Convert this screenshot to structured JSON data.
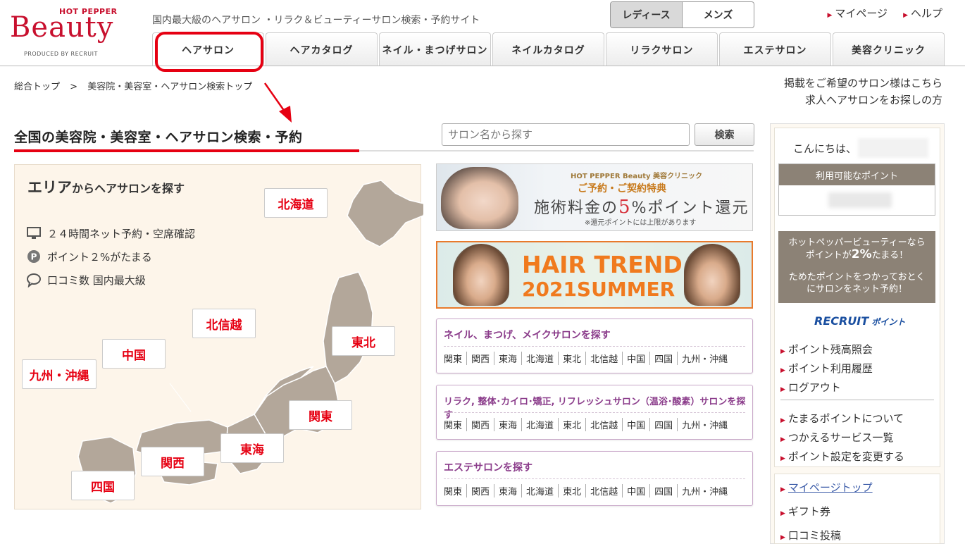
{
  "header": {
    "logo_top": "HOT PEPPER",
    "logo_main": "Beauty",
    "logo_sub": "PRODUCED BY RECRUIT",
    "tagline": "国内最大級のヘアサロン ・リラク＆ビューティーサロン検索・予約サイト",
    "gender": [
      "レディース",
      "メンズ"
    ],
    "mypage": "マイページ",
    "help": "ヘルプ"
  },
  "tabs": [
    "ヘアサロン",
    "ヘアカタログ",
    "ネイル・まつげサロン",
    "ネイルカタログ",
    "リラクサロン",
    "エステサロン",
    "美容クリニック"
  ],
  "breadcrumb": [
    "総合トップ",
    ">",
    "美容院・美容室・ヘアサロン検索トップ"
  ],
  "right_links": [
    "掲載をご希望のサロン様はこちら",
    "求人ヘアサロンをお探しの方"
  ],
  "page_title": "全国の美容院・美容室・ヘアサロン検索・予約",
  "search": {
    "placeholder": "サロン名から探す",
    "button": "検索"
  },
  "area": {
    "title_big": "エリア",
    "title_rest": "からヘアサロンを探す",
    "features": [
      "２４時間ネット予約・空席確認",
      "ポイント２%がたまる",
      "口コミ数 国内最大級"
    ],
    "feature_icon_labels": [
      "",
      "P",
      ""
    ],
    "regions": {
      "hokkaido": "北海道",
      "tohoku": "東北",
      "hokushinetsu": "北信越",
      "kanto": "関東",
      "tokai": "東海",
      "kansai": "関西",
      "chugoku": "中国",
      "shikoku": "四国",
      "kyushu": "九州・沖縄"
    }
  },
  "banner1": {
    "top": "HOT PEPPER Beauty 美容クリニック",
    "mid": "ご予約・ご契約特典",
    "big_pre": "施術料金の",
    "big_pct": "5",
    "big_post": "%ポイント還元",
    "note": "※還元ポイントには上限があります"
  },
  "banner2": {
    "line1": "HAIR TREND",
    "line2": "2021SUMMER"
  },
  "search_boxes": [
    {
      "title": "ネイル、まつげ、メイクサロンを探す"
    },
    {
      "title": "リラク, 整体･カイロ･矯正, リフレッシュサロン（温浴･酸素）サロンを探す"
    },
    {
      "title": "エステサロンを探す"
    }
  ],
  "region_links": [
    "関東",
    "関西",
    "東海",
    "北海道",
    "東北",
    "北信越",
    "中国",
    "四国",
    "九州・沖縄"
  ],
  "sidebar": {
    "greeting": "こんにちは、",
    "points_label": "利用可能なポイント",
    "promo1": "ホットペッパービューティーなら",
    "promo2a": "ポイントが",
    "promo2b": "2%",
    "promo2c": "たまる！",
    "promo3": "ためたポイントをつかっておとく",
    "promo4": "にサロンをネット予約！",
    "recruit_main": "RECRUIT",
    "recruit_sub": "ポイント",
    "links1": [
      "ポイント残高照会",
      "ポイント利用履歴",
      "ログアウト"
    ],
    "links2": [
      "たまるポイントについて",
      "つかえるサービス一覧",
      "ポイント設定を変更する"
    ],
    "mypage_top": "マイページトップ",
    "gift": "ギフト券",
    "review": "口コミ投稿"
  }
}
